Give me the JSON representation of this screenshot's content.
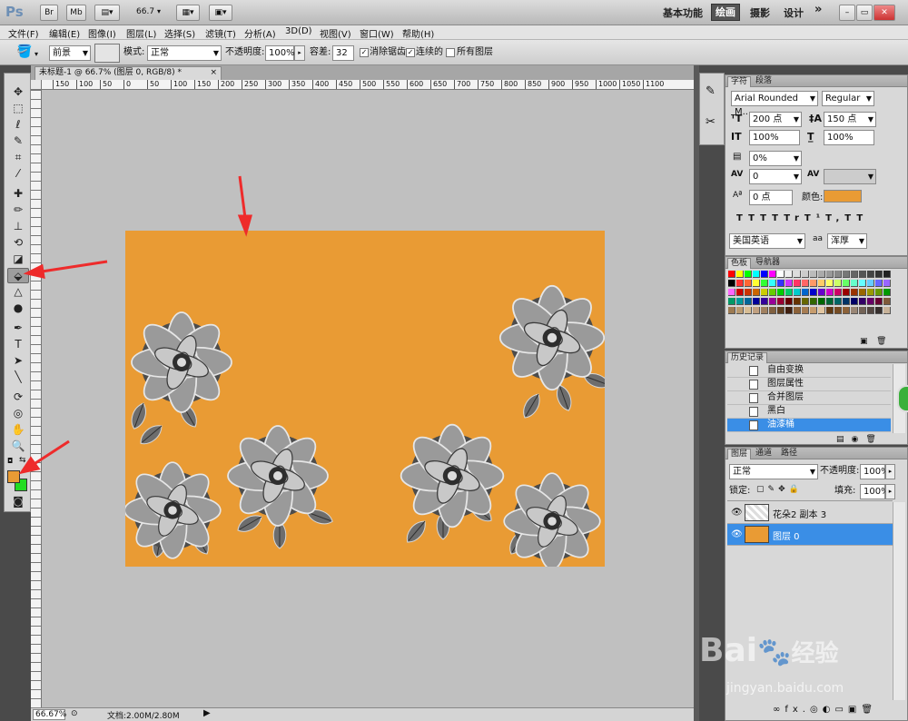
{
  "appbar": {
    "logo": "Ps",
    "br": "Br",
    "mb": "Mb",
    "zoom": "66.7",
    "workspaces": [
      "基本功能",
      "绘画",
      "摄影",
      "设计"
    ],
    "more": "»"
  },
  "menu": [
    "文件(F)",
    "编辑(E)",
    "图像(I)",
    "图层(L)",
    "选择(S)",
    "滤镜(T)",
    "分析(A)",
    "3D(D)",
    "视图(V)",
    "窗口(W)",
    "帮助(H)"
  ],
  "options": {
    "fill_source": "前景",
    "mode_label": "模式:",
    "mode_value": "正常",
    "opacity_label": "不透明度:",
    "opacity_value": "100%",
    "tolerance_label": "容差:",
    "tolerance_value": "32",
    "antialias_label": "消除锯齿",
    "contiguous_label": "连续的",
    "all_layers_label": "所有图层"
  },
  "document": {
    "tab_title": "未标题-1 @ 66.7% (图层 0, RGB/8) *",
    "close": "×",
    "ruler_ticks": [
      "150",
      "100",
      "50",
      "0",
      "50",
      "100",
      "150",
      "200",
      "250",
      "300",
      "350",
      "400",
      "450",
      "500",
      "550",
      "600",
      "650",
      "700",
      "750",
      "800",
      "850",
      "900",
      "950",
      "1000",
      "1050",
      "1100"
    ],
    "canvas_color": "#e99b34"
  },
  "status": {
    "zoom": "66.67%",
    "doc": "文档:2.00M/2.80M"
  },
  "character": {
    "tabs": [
      "字符",
      "段落"
    ],
    "font": "Arial Rounded M...",
    "style": "Regular",
    "size": "200 点",
    "leading": "150 点",
    "vscale": "100%",
    "hscale": "100%",
    "tsume": "0%",
    "kerning": "0",
    "tracking": "",
    "baseline": "0 点",
    "color_label": "颜色:",
    "language": "美国英语",
    "aa_icon": "aa",
    "aa": "浑厚",
    "type_buttons": [
      "T",
      "T",
      "TT",
      "Tr",
      "T¹",
      "T,",
      "T",
      "T"
    ]
  },
  "swatches": {
    "tabs": [
      "色板",
      "导航器"
    ],
    "colors": [
      "#ff0000",
      "#ffff00",
      "#00ff00",
      "#00ffff",
      "#0000ff",
      "#ff00ff",
      "#ffffff",
      "#eeeeee",
      "#dddddd",
      "#cccccc",
      "#bbbbbb",
      "#aaaaaa",
      "#999999",
      "#888888",
      "#777777",
      "#666666",
      "#555555",
      "#444444",
      "#333333",
      "#222222",
      "#000000",
      "#ff3333",
      "#ff6633",
      "#ffff33",
      "#33ff33",
      "#33ffff",
      "#3333ff",
      "#cc33ff",
      "#ff3366",
      "#ff6666",
      "#ff9966",
      "#ffcc66",
      "#ffff66",
      "#ccff66",
      "#66ff66",
      "#66ffcc",
      "#66ffff",
      "#66ccff",
      "#6666ff",
      "#9966ff",
      "#ff66ff",
      "#cc0000",
      "#cc3300",
      "#cc6600",
      "#cccc00",
      "#66cc00",
      "#00cc00",
      "#00cc66",
      "#00cccc",
      "#0066cc",
      "#0000cc",
      "#6600cc",
      "#cc00cc",
      "#cc0066",
      "#990000",
      "#993300",
      "#996600",
      "#999900",
      "#669900",
      "#009900",
      "#009966",
      "#009999",
      "#006699",
      "#000099",
      "#330099",
      "#990099",
      "#990033",
      "#660000",
      "#663300",
      "#666600",
      "#336600",
      "#006600",
      "#006633",
      "#006666",
      "#003366",
      "#000066",
      "#330066",
      "#660066",
      "#660033",
      "#7f5a3a",
      "#9c7a52",
      "#b99a70",
      "#d7bd94",
      "#c0a080",
      "#a08060",
      "#806040",
      "#604020",
      "#402010",
      "#8c6239",
      "#a67c52",
      "#c69c6d",
      "#e2c6a1",
      "#603913",
      "#754c24",
      "#8c6239",
      "#998675",
      "#736357",
      "#534741",
      "#362f2d",
      "#c7b299"
    ]
  },
  "history": {
    "tabs": [
      "历史记录"
    ],
    "items": [
      "自由变换",
      "图层属性",
      "合并图层",
      "黑白",
      "油漆桶"
    ]
  },
  "layers": {
    "tabs": [
      "图层",
      "通道",
      "路径"
    ],
    "blend": "正常",
    "opacity_label": "不透明度:",
    "opacity": "100%",
    "lock_label": "锁定:",
    "fill_label": "填充:",
    "fill": "100%",
    "items": [
      "花朵2 副本 3",
      "图层 0"
    ],
    "bottom_icons": [
      "∞",
      "fx.",
      "◎",
      "◐",
      "▭",
      "▣",
      "🗑"
    ]
  },
  "watermark": {
    "brand": "Bai",
    "brand2": "经验",
    "url": "jingyan.baidu.com"
  },
  "colors": {
    "foreground": "#e99b34",
    "background": "#22dd22",
    "accent": "#3a8ee6",
    "arrow": "#ee2b2b"
  }
}
